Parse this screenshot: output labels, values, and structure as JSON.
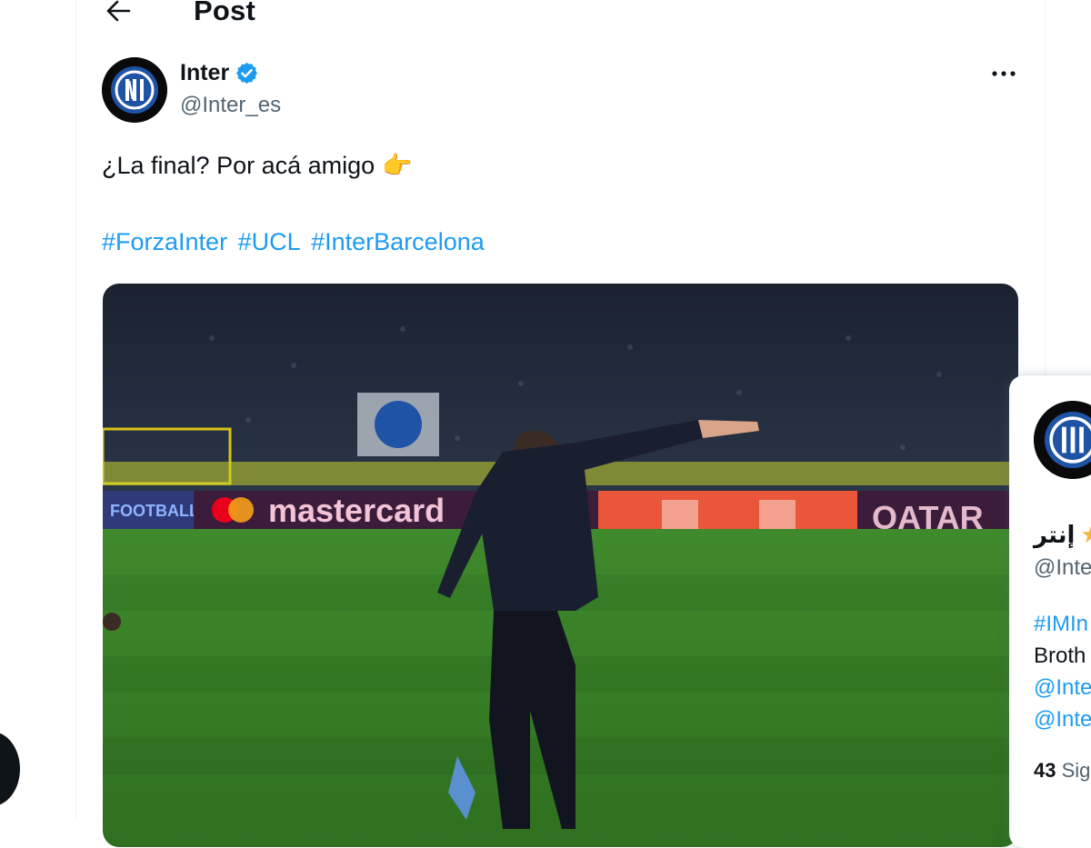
{
  "header": {
    "title": "Post"
  },
  "post": {
    "author_name": "Inter",
    "author_handle": "@Inter_es",
    "text": "¿La final? Por acá amigo",
    "emoji": "👉",
    "hashtags": [
      "#ForzaInter",
      "#UCL",
      "#InterBarcelona"
    ]
  },
  "media": {
    "boards": {
      "mastercard": "mastercard",
      "qatar": "QATAR",
      "football": "FOOTBALL"
    }
  },
  "hover_card": {
    "name": "إنتر",
    "handle": "@Inte",
    "bio_lines": [
      {
        "text": "#IMIn",
        "link": true
      },
      {
        "text": "Broth",
        "link": false
      },
      {
        "text": "@Inte",
        "link": true
      },
      {
        "text": "@Inte",
        "link": true
      }
    ],
    "followers_count": "43",
    "followers_label": "Sig"
  },
  "colors": {
    "accent": "#1d9bf0",
    "text": "#0f1419",
    "muted": "#536471",
    "verified": "#1d9bf0",
    "inter_blue": "#1f53a6"
  },
  "icons": [
    "back-arrow-icon",
    "verified-badge-icon",
    "more-options-icon",
    "inter-logo-icon",
    "pointing-hand-icon",
    "star-icon"
  ]
}
